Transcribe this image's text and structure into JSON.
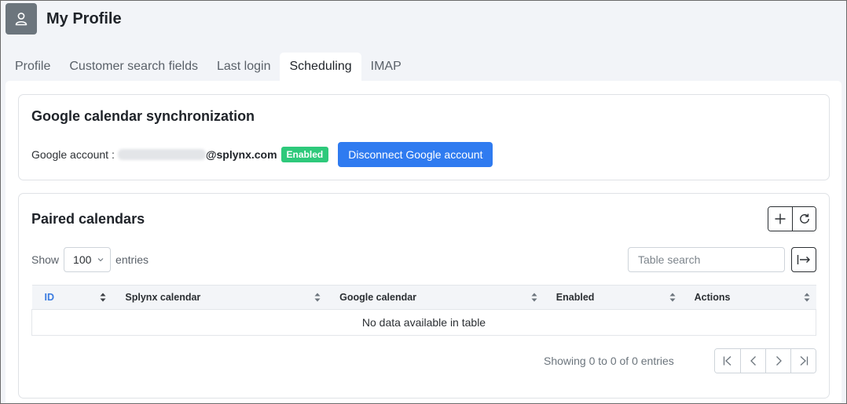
{
  "header": {
    "title": "My Profile",
    "avatar_icon": "user-icon"
  },
  "tabs": [
    {
      "label": "Profile",
      "active": false
    },
    {
      "label": "Customer search fields",
      "active": false
    },
    {
      "label": "Last login",
      "active": false
    },
    {
      "label": "Scheduling",
      "active": true
    },
    {
      "label": "IMAP",
      "active": false
    }
  ],
  "sync": {
    "title": "Google calendar synchronization",
    "account_label": "Google account :",
    "account_domain": "@splynx.com",
    "status_badge": "Enabled",
    "disconnect_label": "Disconnect Google account",
    "badge_color": "#2ec97b",
    "button_color": "#2f7bf0"
  },
  "paired": {
    "title": "Paired calendars",
    "actions": [
      "plus-icon",
      "refresh-icon"
    ],
    "show_label": "Show",
    "page_length": "100",
    "entries_label": "entries",
    "search_placeholder": "Table search",
    "export_icon": "export-icon",
    "columns": [
      "ID",
      "Splynx calendar",
      "Google calendar",
      "Enabled",
      "Actions"
    ],
    "empty_message": "No data available in table",
    "info": "Showing 0 to 0 of 0 entries",
    "pagination": [
      "first-page-icon",
      "prev-page-icon",
      "next-page-icon",
      "last-page-icon"
    ]
  }
}
